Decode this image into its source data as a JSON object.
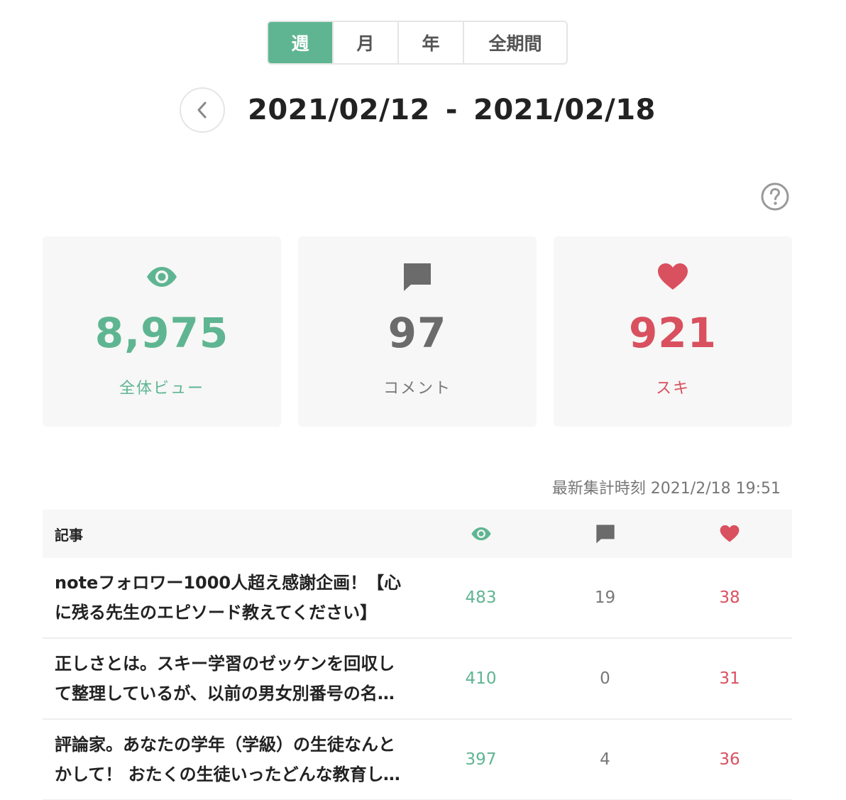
{
  "tabs": [
    {
      "label": "週",
      "active": true
    },
    {
      "label": "月",
      "active": false
    },
    {
      "label": "年",
      "active": false
    },
    {
      "label": "全期間",
      "active": false
    }
  ],
  "range": {
    "start": "2021/02/12",
    "separator": "-",
    "end": "2021/02/18"
  },
  "icons": {
    "prev": "chevron-left-icon",
    "help": "question-circle-icon",
    "views": "eye-icon",
    "comments": "comment-icon",
    "likes": "heart-icon"
  },
  "summary": {
    "views": {
      "value": "8,975",
      "label": "全体ビュー"
    },
    "comments": {
      "value": "97",
      "label": "コメント"
    },
    "likes": {
      "value": "921",
      "label": "スキ"
    }
  },
  "updated": {
    "label": "最新集計時刻",
    "value": "2021/2/18 19:51"
  },
  "table": {
    "header": {
      "title": "記事"
    },
    "rows": [
      {
        "title": "noteフォロワー1000人超え感謝企画！【心に残る先生のエピソード教えてください】",
        "views": "483",
        "comments": "19",
        "likes": "38"
      },
      {
        "title": "正しさとは。スキー学習のゼッケンを回収して整理しているが、以前の男女別番号の名残で",
        "views": "410",
        "comments": "0",
        "likes": "31"
      },
      {
        "title": "評論家。あなたの学年（学級）の生徒なんとかして！ おたくの生徒いったどんな教育してるの",
        "views": "397",
        "comments": "4",
        "likes": "36"
      }
    ]
  },
  "colors": {
    "accent": "#5fb592",
    "like": "#d9505f",
    "neutral": "#6b6b6b",
    "card_bg": "#f6f7f6"
  }
}
